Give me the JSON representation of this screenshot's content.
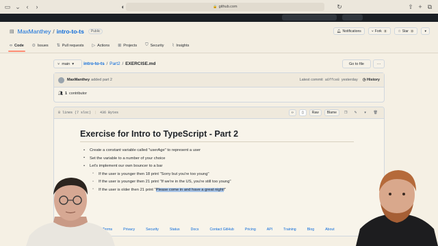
{
  "browser": {
    "url": "github.com"
  },
  "repo": {
    "owner": "MaxManthey",
    "separator": "/",
    "name": "intro-to-ts",
    "visibility": "Public",
    "actions": {
      "notifications": "Notifications",
      "fork": "Fork",
      "fork_count": "0",
      "star": "Star",
      "star_count": "0"
    }
  },
  "tabs": [
    {
      "label": "Code",
      "icon": "code-icon"
    },
    {
      "label": "Issues",
      "icon": "issue-icon"
    },
    {
      "label": "Pull requests",
      "icon": "pull-request-icon"
    },
    {
      "label": "Actions",
      "icon": "play-icon"
    },
    {
      "label": "Projects",
      "icon": "table-icon"
    },
    {
      "label": "Security",
      "icon": "shield-icon"
    },
    {
      "label": "Insights",
      "icon": "graph-icon"
    }
  ],
  "file_nav": {
    "branch": "main",
    "path_root": "intro-to-ts",
    "path_folder": "Part2",
    "path_file": "EXERCISE.md",
    "go_to_file": "Go to file",
    "more": "···"
  },
  "commit": {
    "author": "MaxManthey",
    "message": "added part 2",
    "latest_label": "Latest commit",
    "sha": "a6ffce8",
    "when": "yesterday",
    "history": "History",
    "contributors_count": "1",
    "contributors_label": "contributor"
  },
  "file": {
    "lines": "8 lines (7 sloc)",
    "size": "436 Bytes",
    "raw": "Raw",
    "blame": "Blame"
  },
  "markdown": {
    "title": "Exercise for Intro to TypeScript - Part 2",
    "items": [
      "Create a constant variable called \"userAge\" to represent a user",
      "Set the variable to a number of your choice",
      "Let's implement our own bouncer to a bar"
    ],
    "sub_items": [
      "If the user is younger then 18 print \"Sorry but you're too young\"",
      "If the user is younger then 21 print \"If we're in the US, you're still too young\""
    ],
    "last_prefix": "If the user is older then 21 print \"",
    "last_highlight": "Please come in and have a great night",
    "last_suffix": "!\""
  },
  "footer": {
    "links": [
      "Terms",
      "Privacy",
      "Security",
      "Status",
      "Docs",
      "Contact GitHub",
      "Pricing",
      "API",
      "Training",
      "Blog",
      "About"
    ]
  },
  "colors": {
    "link": "#0969da",
    "tab_underline": "#fd8c73",
    "selection": "#a9c5e8"
  }
}
